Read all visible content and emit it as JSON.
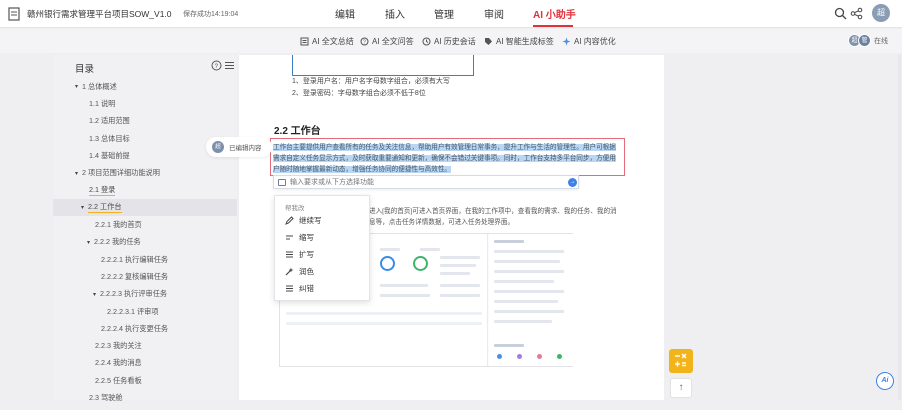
{
  "app": {
    "doc_title": "赣州银行需求管理平台项目SOW_V1.0",
    "save_status": "保存成功14:19:04",
    "avatar_text": "超"
  },
  "menu_tabs": [
    {
      "label": "编辑"
    },
    {
      "label": "插入"
    },
    {
      "label": "管理"
    },
    {
      "label": "审阅"
    },
    {
      "label": "AI 小助手"
    }
  ],
  "ai_tools": [
    {
      "label": "AI 全文总结",
      "icon": "summary-icon"
    },
    {
      "label": "AI 全文问答",
      "icon": "qa-icon"
    },
    {
      "label": "AI 历史会话",
      "icon": "history-icon"
    },
    {
      "label": "AI 智能生成标签",
      "icon": "tag-icon"
    },
    {
      "label": "AI 内容优化",
      "icon": "optimize-icon"
    }
  ],
  "online": {
    "avatars": [
      "超",
      "管"
    ],
    "label": "在线"
  },
  "sidebar": {
    "title": "目录",
    "items": [
      {
        "label": "1 总体概述",
        "caret": "▾"
      },
      {
        "label": "1.1 说明",
        "caret": ""
      },
      {
        "label": "1.2 适用范围",
        "caret": ""
      },
      {
        "label": "1.3 总体目标",
        "caret": ""
      },
      {
        "label": "1.4 基础前提",
        "caret": ""
      },
      {
        "label": "2 项目范围详细功能说明",
        "caret": "▾"
      },
      {
        "label": "2.1 登录",
        "caret": ""
      },
      {
        "label": "2.2 工作台",
        "caret": "▾"
      },
      {
        "label": "2.2.1 我的首页",
        "caret": ""
      },
      {
        "label": "2.2.2 我的任务",
        "caret": "▾"
      },
      {
        "label": "2.2.2.1 执行编辑任务",
        "caret": ""
      },
      {
        "label": "2.2.2.2 复核编辑任务",
        "caret": ""
      },
      {
        "label": "2.2.2.3 执行评审任务",
        "caret": "▾"
      },
      {
        "label": "2.2.2.3.1 评审项",
        "caret": ""
      },
      {
        "label": "2.2.2.4 执行变更任务",
        "caret": ""
      },
      {
        "label": "2.2.3 我的关注",
        "caret": ""
      },
      {
        "label": "2.2.4 我的消息",
        "caret": ""
      },
      {
        "label": "2.2.5 任务看板",
        "caret": ""
      },
      {
        "label": "2.3 驾驶舱",
        "caret": ""
      }
    ]
  },
  "document": {
    "bullets": [
      "1、登录用户名：用户名字母数字组合，必须有大写",
      "2、登录密码：字母数字组合必须不低于8位"
    ],
    "section_heading": "2.2 工作台",
    "selected_paragraph": "工作台主要提供用户查看所有的任务及关注信息，帮助用户有效管理日常事务，提升工作与生活的管理性。用户可根据需求自定义任务显示方式，及时获取重要通知和更新，确保不会错过关键事项。同时，工作台支持多平台同步，方便用户随时随地掌握最新动态，增强任务协同的便捷性与高效性。",
    "ai_input_placeholder": "输入要求或从下方选择功能",
    "send_icon": "→",
    "body_paragraph": "进入[我的首页]可进入首页界面，在我的工作项中，查看我的需求、我的任务、我的消息等，点击任务详情数据，可进入任务处理界面。"
  },
  "dropdown": {
    "header": "帮我改",
    "items": [
      {
        "label": "继续写",
        "icon": "pen-icon"
      },
      {
        "label": "缩写",
        "icon": "shorten-icon"
      },
      {
        "label": "扩写",
        "icon": "expand-icon"
      },
      {
        "label": "润色",
        "icon": "polish-icon"
      },
      {
        "label": "纠错",
        "icon": "correct-icon"
      }
    ]
  },
  "comment_tag": {
    "avatar": "超",
    "label": "已编辑内容"
  },
  "colors": {
    "accent_red": "#e0323a",
    "selection_blue": "#b9d7f5",
    "fab_yellow": "#f3b41b",
    "ai_blue": "#3c82e4"
  },
  "floating": {
    "calc_symbol": "−×\n+=",
    "top_symbol": "↑",
    "ai_label": "Ai"
  }
}
